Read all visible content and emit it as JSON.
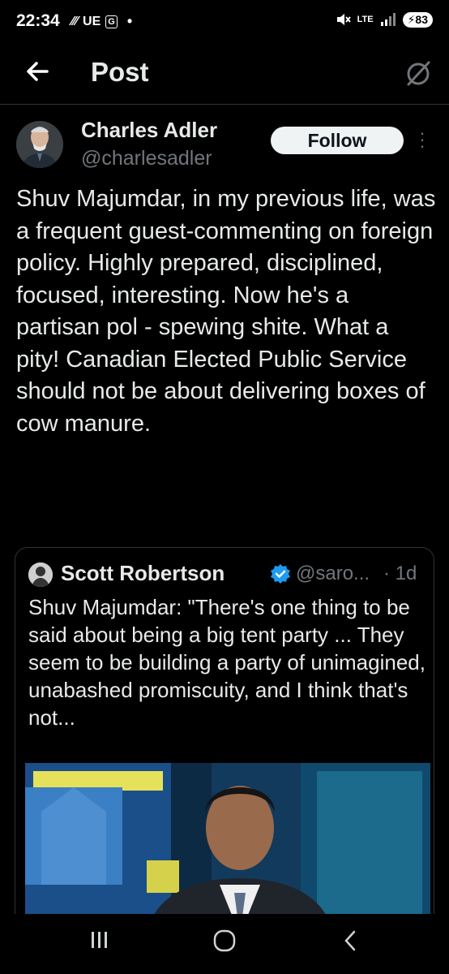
{
  "status_bar": {
    "time": "22:34",
    "left_icons_text": "UE",
    "left_icon_box": "G",
    "dot": "•",
    "network": "LTE",
    "battery": "83"
  },
  "header": {
    "title": "Post",
    "back_icon": "arrow-left-icon",
    "grok_icon": "grok-icon"
  },
  "post": {
    "author_name": "Charles Adler",
    "author_handle": "@charlesadler",
    "follow_label": "Follow",
    "text": "Shuv Majumdar, in my previous life,  was a frequent guest-commenting on foreign policy. Highly prepared, disciplined, focused, interesting. Now he's a partisan pol - spewing shite. What a pity! Canadian Elected Public Service should not be about delivering boxes of cow manure."
  },
  "quote": {
    "author_name": "Scott Robertson",
    "author_handle": "@saro...",
    "time": "· 1d",
    "text": "Shuv Majumdar: \"There's one thing to be said about being a big tent party ... They seem to be building a party of unimagined, unabashed promiscuity, and I think that's not..."
  },
  "colors": {
    "background": "#000000",
    "text_primary": "#e7e9ea",
    "text_secondary": "#71767b",
    "border": "#2f3336",
    "verified": "#1d9bf0",
    "follow_bg": "#eff3f4"
  }
}
